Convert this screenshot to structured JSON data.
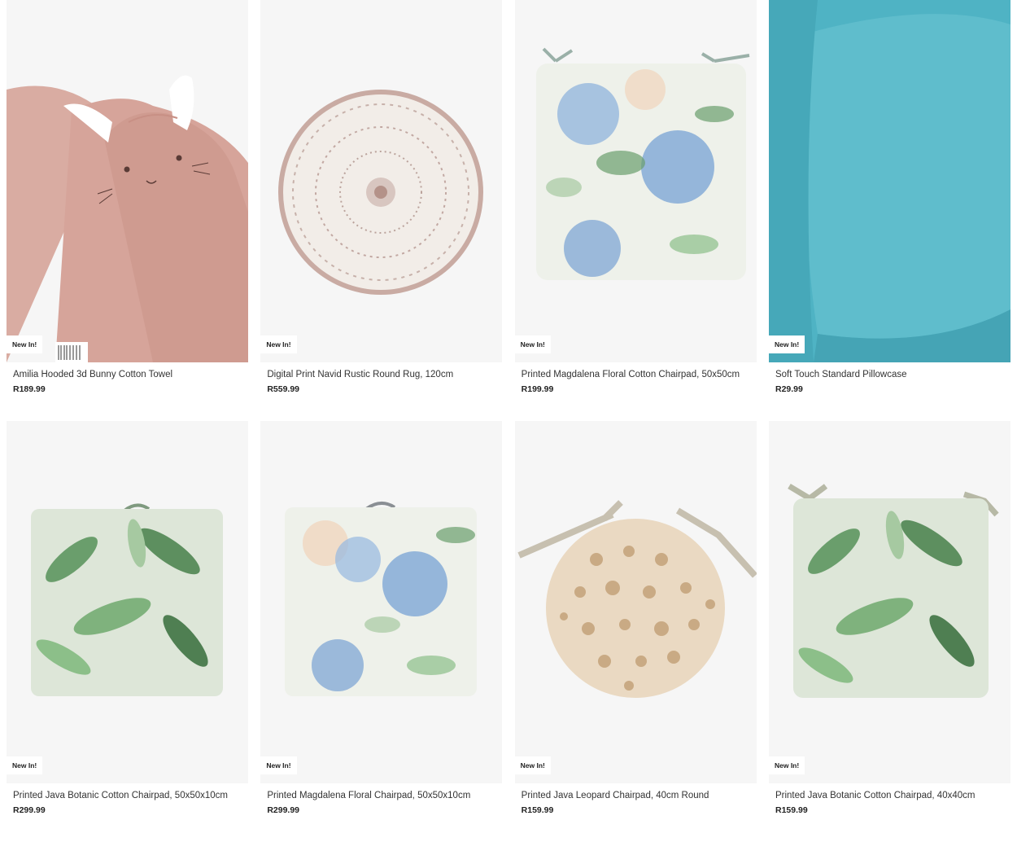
{
  "products": [
    {
      "badge": "New In!",
      "title": "Amilia Hooded 3d Bunny Cotton Towel",
      "price": "R189.99"
    },
    {
      "badge": "New In!",
      "title": "Digital Print Navid Rustic Round Rug, 120cm",
      "price": "R559.99"
    },
    {
      "badge": "New In!",
      "title": "Printed Magdalena Floral Cotton Chairpad, 50x50cm",
      "price": "R199.99"
    },
    {
      "badge": "New In!",
      "title": "Soft Touch Standard Pillowcase",
      "price": "R29.99"
    },
    {
      "badge": "New In!",
      "title": "Printed Java Botanic Cotton Chairpad, 50x50x10cm",
      "price": "R299.99"
    },
    {
      "badge": "New In!",
      "title": "Printed Magdalena Floral Chairpad, 50x50x10cm",
      "price": "R299.99"
    },
    {
      "badge": "New In!",
      "title": "Printed Java Leopard Chairpad, 40cm Round",
      "price": "R159.99"
    },
    {
      "badge": "New In!",
      "title": "Printed Java Botanic Cotton Chairpad, 40x40cm",
      "price": "R159.99"
    }
  ],
  "colors": {
    "image_bg": "#f6f6f6",
    "towel_pink": "#d6a49a",
    "pillow_teal": "#4fb3c4",
    "floral_blue": "#7ea7d6",
    "leaf_green": "#6a9e6c",
    "leopard_beige": "#d8c2a2"
  }
}
